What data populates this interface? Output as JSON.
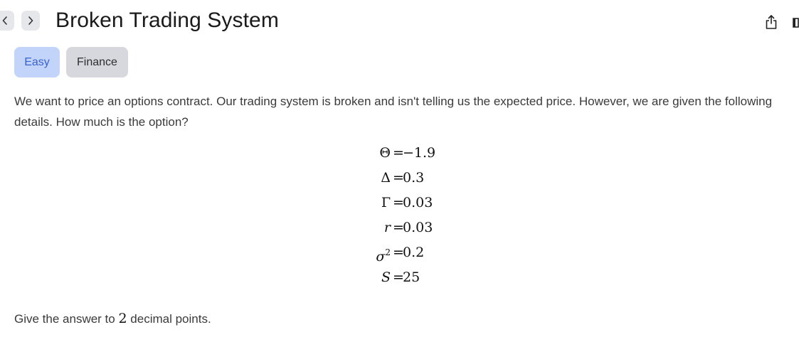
{
  "header": {
    "title": "Broken Trading System",
    "back_icon": "chevron-left-icon",
    "forward_icon": "chevron-right-icon",
    "share_icon": "share-icon",
    "side_icon": "panel-icon"
  },
  "tags": {
    "difficulty": "Easy",
    "topic": "Finance"
  },
  "question": {
    "text": "We want to price an options contract. Our trading system is broken and isn't telling us the expected price. However, we are given the following details. How much is the option?"
  },
  "givens": [
    {
      "symbol": "Θ",
      "eq": "=",
      "value": "−1.9"
    },
    {
      "symbol": "Δ",
      "eq": "=",
      "value": "0.3"
    },
    {
      "symbol": "Γ",
      "eq": "=",
      "value": "0.03"
    },
    {
      "symbol": "r",
      "eq": "=",
      "value": "0.03"
    },
    {
      "symbol": "σ",
      "superscript": "2",
      "eq": "=",
      "value": "0.2"
    },
    {
      "symbol": "S",
      "eq": "=",
      "value": "25"
    }
  ],
  "footer": {
    "before": "Give the answer to ",
    "number": "2",
    "after": " decimal points."
  },
  "colors": {
    "easy_tag_bg": "#c3d4fb",
    "easy_tag_text": "#3a62cf",
    "topic_tag_bg": "#d7d8dd",
    "nav_button_bg": "#e6e7eb"
  }
}
